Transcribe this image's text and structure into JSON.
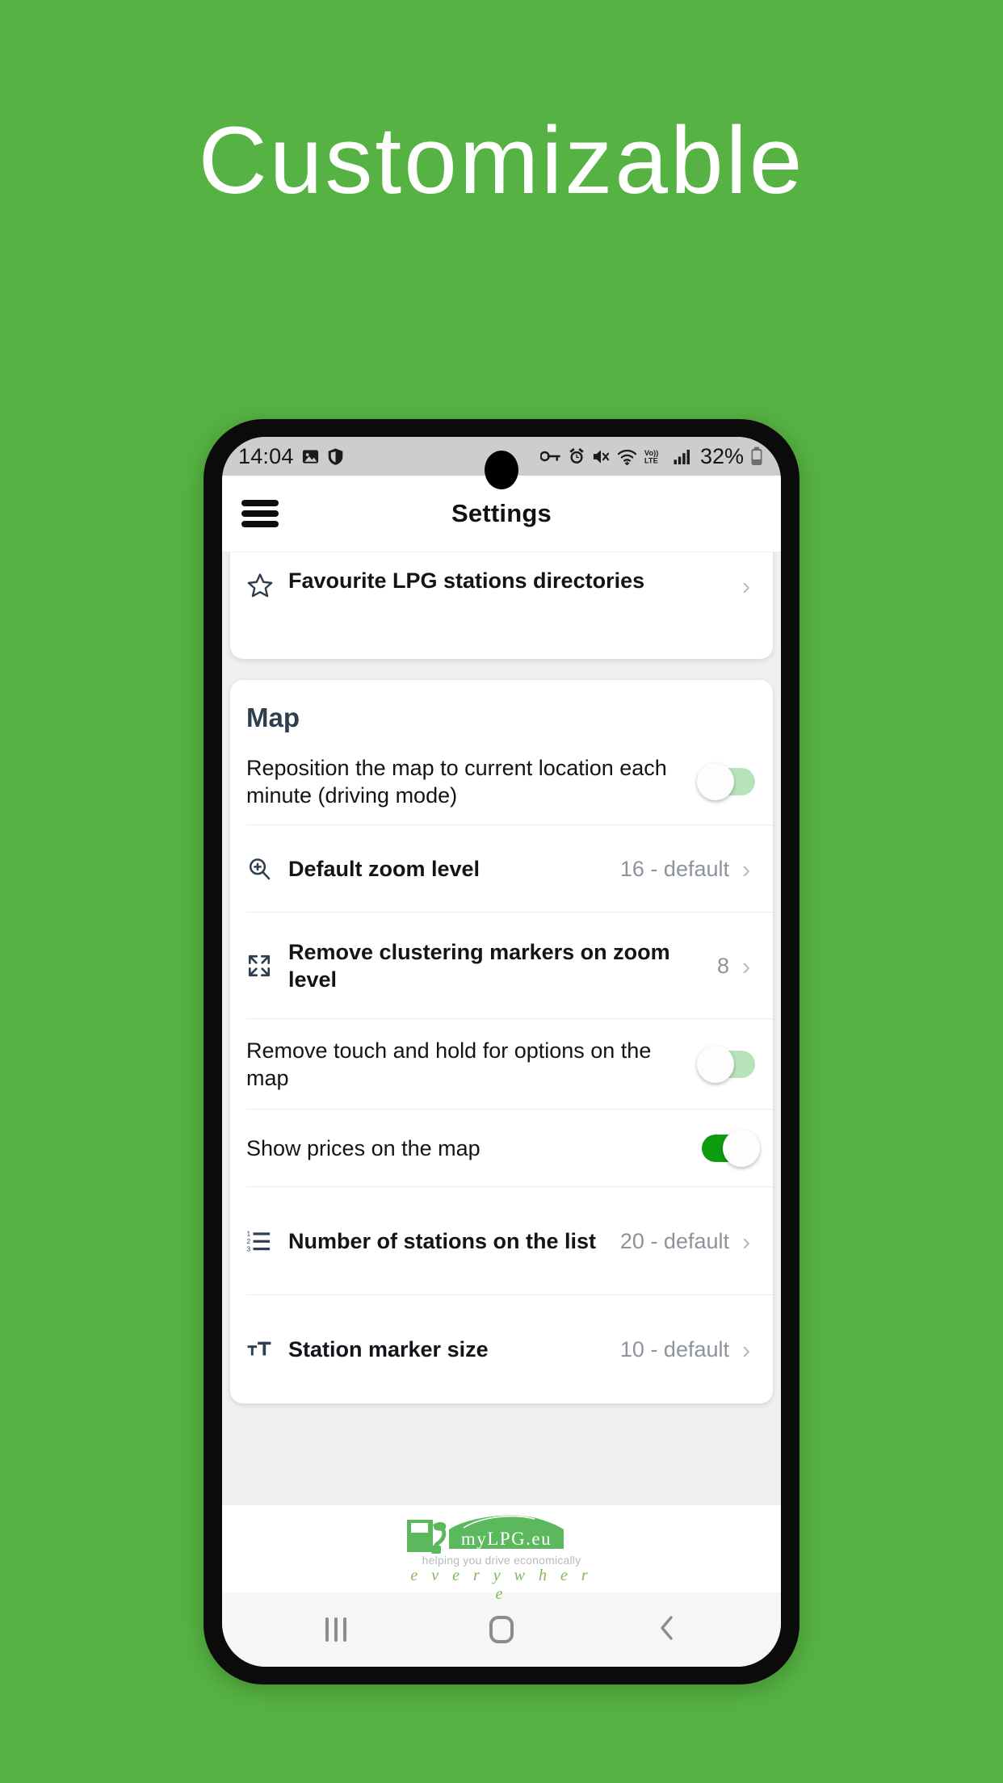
{
  "hero": {
    "title": "Customizable"
  },
  "theme": {
    "background_green": "#56b242",
    "accent_green": "#0b9d0d",
    "toggle_off_track": "#b8e3b8",
    "section_title_color": "#2c3e50"
  },
  "status_bar": {
    "time": "14:04",
    "battery_percent": "32%",
    "left_icons": [
      "photo-icon",
      "shield-icon"
    ],
    "right_icons": [
      "vpn-key-icon",
      "alarm-icon",
      "mute-icon",
      "wifi-icon",
      "volte-icon",
      "signal-icon"
    ],
    "network_label": "Vo)) LTE"
  },
  "app_bar": {
    "menu_icon": "hamburger-icon",
    "title": "Settings"
  },
  "cards": [
    {
      "id": "favourites-card",
      "rows": [
        {
          "type": "nav",
          "icon": "star-icon",
          "label": "Favourite LPG stations directories",
          "bold": true,
          "value": "",
          "chevron": "›"
        }
      ]
    },
    {
      "id": "map-card",
      "section_title": "Map",
      "rows": [
        {
          "type": "toggle",
          "icon": "",
          "label": "Reposition the map to current location each minute (driving mode)",
          "bold": false,
          "toggle": "off"
        },
        {
          "type": "nav",
          "icon": "zoom-in-icon",
          "label": "Default zoom level",
          "bold": true,
          "value": "16 - default",
          "chevron": "›"
        },
        {
          "type": "nav",
          "icon": "expand-arrows-icon",
          "label": "Remove clustering markers on zoom level",
          "bold": true,
          "value": "8",
          "chevron": "›"
        },
        {
          "type": "toggle",
          "icon": "",
          "label": "Remove touch and hold for options on the map",
          "bold": false,
          "toggle": "off"
        },
        {
          "type": "toggle",
          "icon": "",
          "label": "Show prices on the map",
          "bold": false,
          "toggle": "on"
        },
        {
          "type": "nav",
          "icon": "numbered-list-icon",
          "label": "Number of stations on the list",
          "bold": true,
          "value": "20 - default",
          "chevron": "›"
        },
        {
          "type": "nav",
          "icon": "text-size-icon",
          "label": "Station marker size",
          "bold": true,
          "value": "10 - default",
          "chevron": "›"
        }
      ]
    }
  ],
  "footer_logo": {
    "brand": "myLPG.eu",
    "tagline": "helping you drive economically",
    "tagline2": "e v e r y w h e r e"
  },
  "nav_bar": {
    "recent_label": "recent-apps",
    "home_label": "home",
    "back_label": "back"
  }
}
